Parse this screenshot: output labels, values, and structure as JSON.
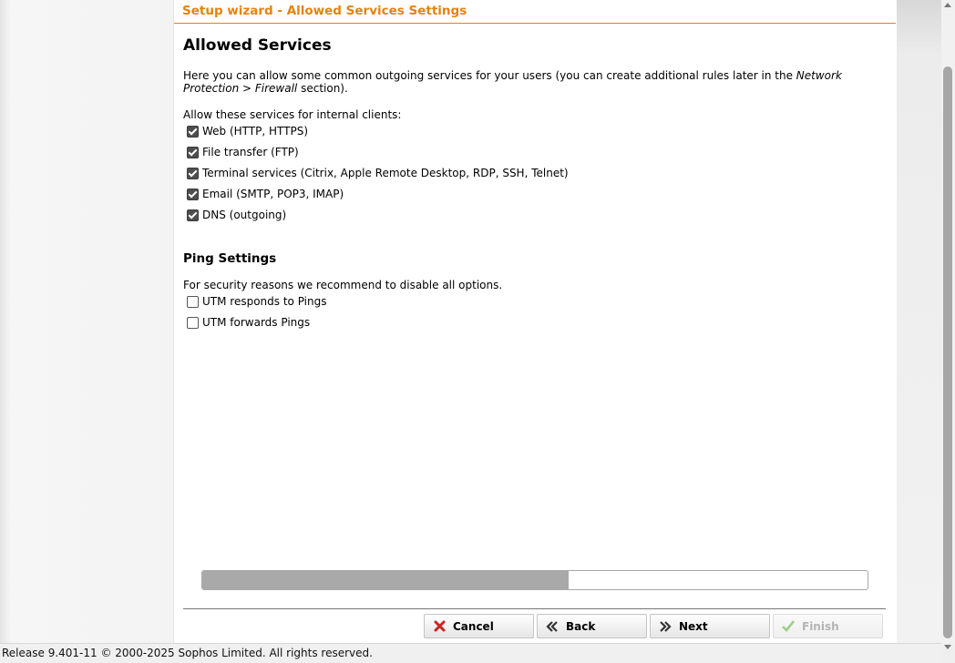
{
  "wizard": {
    "title": "Setup wizard - Allowed Services Settings",
    "heading": "Allowed Services",
    "intro_before": "Here you can allow some common outgoing services for your users (you can create additional rules later in the ",
    "intro_emphasis": "Network Protection > Firewall",
    "intro_after": " section).",
    "services_label": "Allow these services for internal clients:",
    "services": [
      {
        "label": "Web (HTTP, HTTPS)",
        "checked": true
      },
      {
        "label": "File transfer (FTP)",
        "checked": true
      },
      {
        "label": "Terminal services (Citrix, Apple Remote Desktop, RDP, SSH, Telnet)",
        "checked": true
      },
      {
        "label": "Email (SMTP, POP3, IMAP)",
        "checked": true
      },
      {
        "label": "DNS (outgoing)",
        "checked": true
      }
    ],
    "ping_heading": "Ping Settings",
    "ping_note": "For security reasons we recommend to disable all options.",
    "ping_options": [
      {
        "label": "UTM responds to Pings",
        "checked": false
      },
      {
        "label": "UTM forwards Pings",
        "checked": false
      }
    ],
    "progress_fraction": 0.55
  },
  "buttons": {
    "cancel": "Cancel",
    "back": "Back",
    "next": "Next",
    "finish": "Finish"
  },
  "icons": {
    "cancel": "close-icon",
    "back": "double-chevron-left-icon",
    "next": "double-chevron-right-icon",
    "finish": "checkmark-icon"
  },
  "colors": {
    "accent": "#e8820c",
    "cancel_icon": "#cc2222",
    "finish_icon_disabled": "#9ccf8a"
  },
  "footer": {
    "text": "Release 9.401-11  © 2000-2025 Sophos Limited. All rights reserved."
  }
}
